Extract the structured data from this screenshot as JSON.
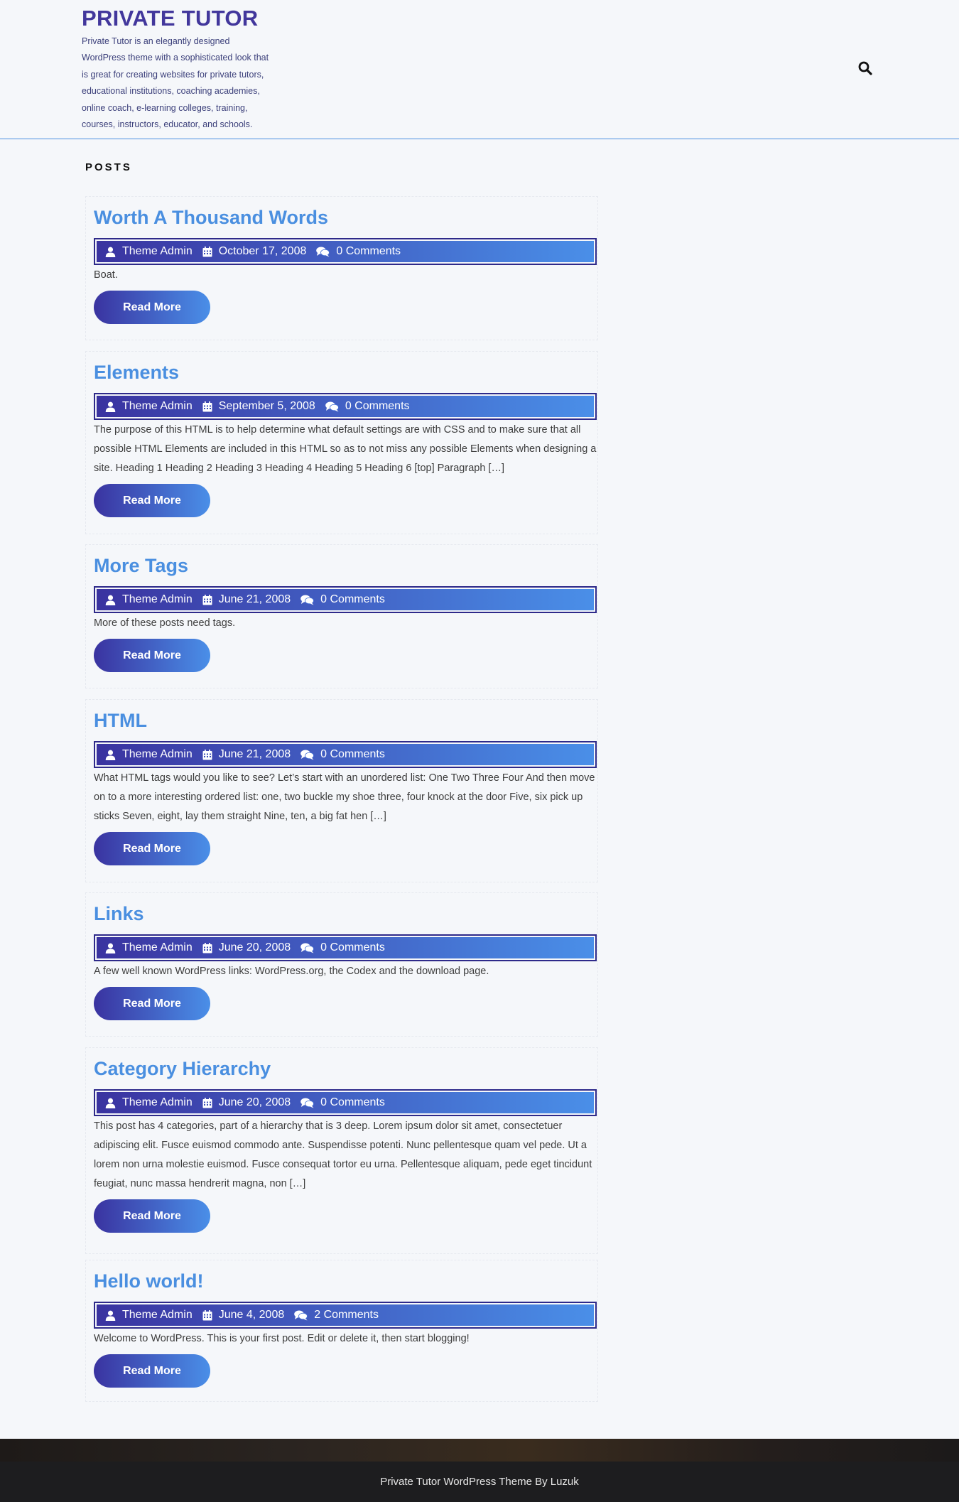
{
  "header": {
    "site_title": "PRIVATE TUTOR",
    "site_description": "Private Tutor is an elegantly designed WordPress theme with a sophisticated look that is great for creating websites for private tutors, educational institutions, coaching academies, online coach, e-learning colleges, training, courses, instructors, educator, and schools."
  },
  "section_label": "POSTS",
  "read_more_label": "Read More",
  "posts": [
    {
      "title": "Worth A Thousand Words",
      "author": "Theme Admin",
      "date": "October 17, 2008",
      "comments": "0 Comments",
      "excerpt": "Boat."
    },
    {
      "title": "Elements",
      "author": "Theme Admin",
      "date": "September 5, 2008",
      "comments": "0 Comments",
      "excerpt": "The purpose of this HTML is to help determine what default settings are with CSS and to make sure that all possible HTML Elements are included in this HTML so as to not miss any possible Elements when designing a site. Heading 1 Heading 2 Heading 3 Heading 4 Heading 5 Heading 6 [top] Paragraph […]"
    },
    {
      "title": "More Tags",
      "author": "Theme Admin",
      "date": "June 21, 2008",
      "comments": "0 Comments",
      "excerpt": "More of these posts need tags."
    },
    {
      "title": "HTML",
      "author": "Theme Admin",
      "date": "June 21, 2008",
      "comments": "0 Comments",
      "excerpt": "What HTML tags would you like to see? Let’s start with an unordered list: One Two Three Four And then move on to a more interesting ordered list: one, two buckle my shoe three, four knock at the door Five, six pick up sticks Seven, eight, lay them straight Nine, ten, a big fat hen […]"
    },
    {
      "title": "Links",
      "author": "Theme Admin",
      "date": "June 20, 2008",
      "comments": "0 Comments",
      "excerpt": "A few well known WordPress links: WordPress.org, the Codex and the download page."
    },
    {
      "title": "Category Hierarchy",
      "author": "Theme Admin",
      "date": "June 20, 2008",
      "comments": "0 Comments",
      "excerpt": "This post has 4 categories, part of a hierarchy that is 3 deep. Lorem ipsum dolor sit amet, consectetuer adipiscing elit. Fusce euismod commodo ante. Suspendisse potenti. Nunc pellentesque quam vel pede. Ut a lorem non urna molestie euismod. Fusce consequat tortor eu urna. Pellentesque aliquam, pede eget tincidunt feugiat, nunc massa hendrerit magna, non […]"
    },
    {
      "title": "Hello world!",
      "author": "Theme Admin",
      "date": "June 4, 2008",
      "comments": "2 Comments",
      "excerpt": "Welcome to WordPress. This is your first post. Edit or delete it, then start blogging!"
    }
  ],
  "footer": {
    "credit": "Private Tutor WordPress Theme By Luzuk"
  },
  "colors": {
    "brand": "#42379c",
    "accent": "#4a8fe0"
  },
  "icons": {
    "search": "search-icon",
    "author": "user-icon",
    "date": "calendar-icon",
    "comments": "comments-icon"
  }
}
